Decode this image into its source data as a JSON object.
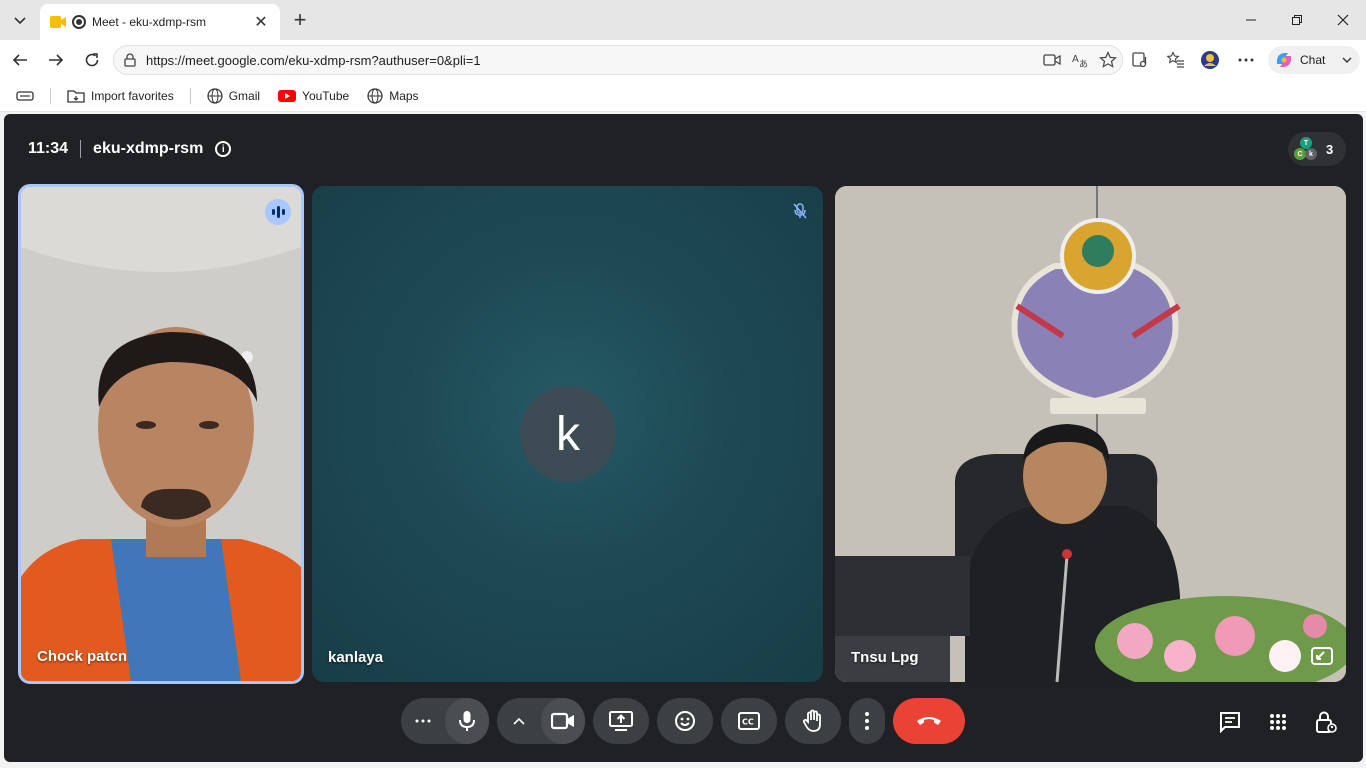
{
  "browser": {
    "tab_title": "Meet - eku-xdmp-rsm",
    "url": "https://meet.google.com/eku-xdmp-rsm?authuser=0&pli=1",
    "chat_label": "Chat",
    "bookmarks": [
      "Import favorites",
      "Gmail",
      "YouTube",
      "Maps"
    ]
  },
  "meet": {
    "time": "11:34",
    "meeting_code": "eku-xdmp-rsm",
    "participant_count": "3",
    "avatar_initials": [
      "T",
      "C",
      "k"
    ],
    "participants": [
      {
        "name": "Chock patcn",
        "state": "speaking"
      },
      {
        "name": "kanlaya",
        "state": "muted",
        "initial": "k"
      },
      {
        "name": "Tnsu Lpg",
        "state": "video"
      }
    ],
    "controls": [
      "more-reactions",
      "microphone",
      "camera-options",
      "camera",
      "present",
      "emoji",
      "captions",
      "raise-hand",
      "more-options",
      "leave-call"
    ],
    "right_controls": [
      "chat",
      "activities",
      "host-controls"
    ]
  },
  "colors": {
    "meet_bg": "#202124",
    "button_bg": "#3c4043",
    "end_call": "#ea4335",
    "speaking_ring": "#a8c7fa"
  }
}
